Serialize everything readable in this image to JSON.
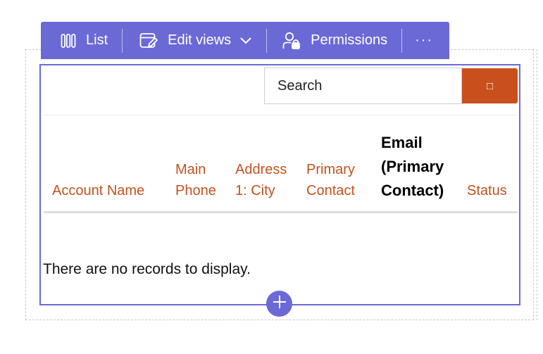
{
  "toolbar": {
    "list_label": "List",
    "edit_views_label": "Edit views",
    "permissions_label": "Permissions",
    "more_label": "···"
  },
  "search": {
    "placeholder": "Search",
    "button_glyph": "□"
  },
  "table": {
    "columns": [
      {
        "lines": [
          "Account Name"
        ]
      },
      {
        "lines": [
          "Main",
          "Phone"
        ]
      },
      {
        "lines": [
          "Address",
          "1: City"
        ]
      },
      {
        "lines": [
          "Primary",
          "Contact"
        ]
      },
      {
        "lines": [
          "Email",
          "(Primary",
          "Contact)"
        ]
      },
      {
        "lines": [
          "Status"
        ]
      }
    ],
    "empty_message": "There are no records to display."
  },
  "colors": {
    "accent": "#6b69d6",
    "search_button": "#c9501c",
    "column_link": "#c0531e"
  },
  "icons": {
    "list": "columns-icon",
    "edit_views": "edit-view-icon",
    "permissions": "user-lock-icon",
    "dropdown": "chevron-down-icon",
    "add": "plus-icon"
  }
}
